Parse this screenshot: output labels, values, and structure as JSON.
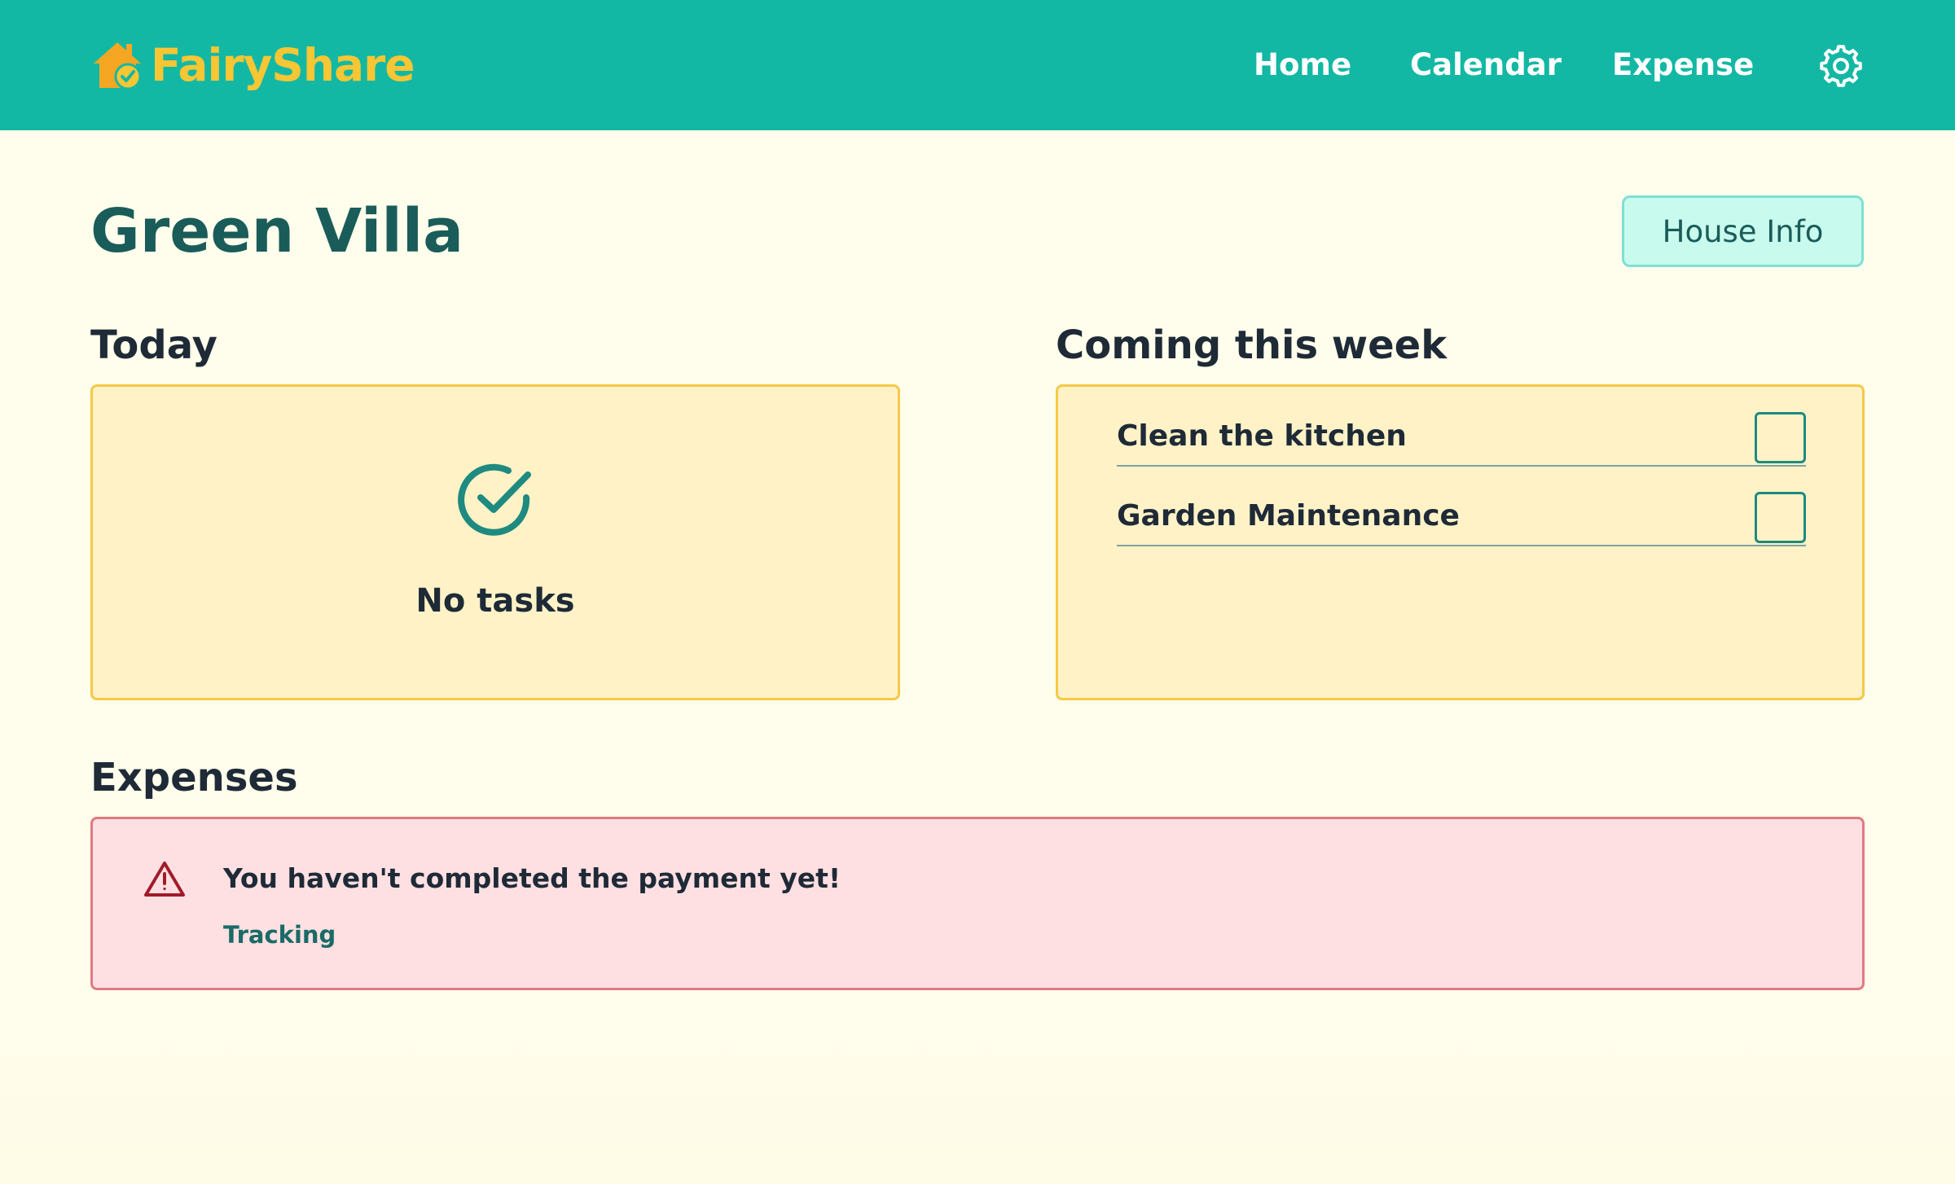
{
  "navbar": {
    "brand_name": "FairyShare",
    "brand_color": "#f7c634",
    "background_color": "#13b8a4",
    "brand_icon": "house-check-icon",
    "links": [
      {
        "label": "Home"
      },
      {
        "label": "Calendar"
      },
      {
        "label": "Expense"
      }
    ],
    "settings_icon": "gear-icon"
  },
  "header": {
    "title": "Green Villa",
    "house_info_label": "House Info"
  },
  "today": {
    "heading": "Today",
    "empty_icon": "check-circle-icon",
    "empty_text": "No tasks"
  },
  "week": {
    "heading": "Coming this week",
    "tasks": [
      {
        "label": "Clean the kitchen",
        "checked": false
      },
      {
        "label": "Garden Maintenance",
        "checked": false
      }
    ]
  },
  "expenses": {
    "heading": "Expenses",
    "alert_icon": "warning-triangle-icon",
    "alert_message": "You haven't completed the payment yet!",
    "alert_link": "Tracking",
    "alert_color": "#e07a82"
  }
}
